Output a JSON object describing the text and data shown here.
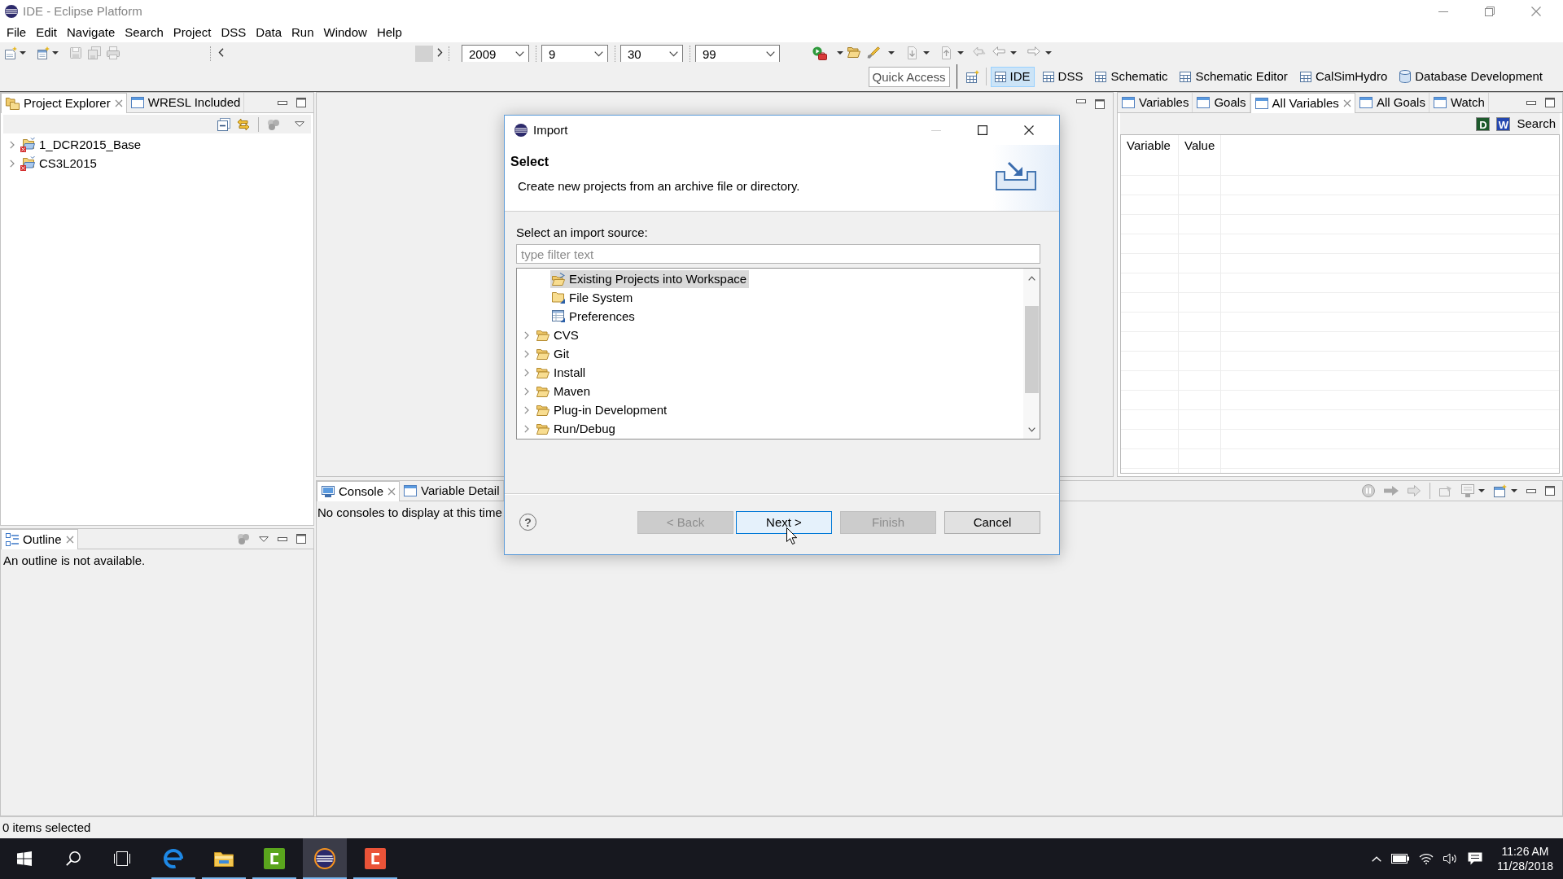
{
  "window": {
    "title": "IDE - Eclipse Platform"
  },
  "menu_bar": [
    "File",
    "Edit",
    "Navigate",
    "Search",
    "Project",
    "DSS",
    "Data",
    "Run",
    "Window",
    "Help"
  ],
  "toolbar": {
    "combos": [
      {
        "value": "2009"
      },
      {
        "value": "9"
      },
      {
        "value": "30"
      },
      {
        "value": "99"
      }
    ],
    "quick_access": {
      "placeholder": "Quick Access"
    },
    "perspectives": [
      {
        "label": "IDE",
        "selected": true
      },
      {
        "label": "DSS",
        "selected": false
      },
      {
        "label": "Schematic",
        "selected": false
      },
      {
        "label": "Schematic Editor",
        "selected": false
      },
      {
        "label": "CalSimHydro",
        "selected": false
      },
      {
        "label": "Database Development",
        "selected": false
      }
    ]
  },
  "project_explorer": {
    "tabs": [
      {
        "label": "Project Explorer",
        "selected": true
      },
      {
        "label": "WRESL Included",
        "selected": false
      }
    ],
    "tree": [
      {
        "label": "1_DCR2015_Base",
        "expanded": false,
        "selected": false
      },
      {
        "label": "CS3L2015",
        "expanded": false,
        "selected": false
      }
    ]
  },
  "outline": {
    "tabs": [
      {
        "label": "Outline",
        "selected": true
      }
    ],
    "message": "An outline is not available."
  },
  "variables_panel": {
    "tabs": [
      {
        "label": "Variables",
        "selected": false
      },
      {
        "label": "Goals",
        "selected": false
      },
      {
        "label": "All Variables",
        "selected": true
      },
      {
        "label": "All Goals",
        "selected": false
      },
      {
        "label": "Watch",
        "selected": false
      }
    ],
    "toolbar": [
      {
        "kind": "badge",
        "label": "D",
        "color": "#1d5a2c"
      },
      {
        "kind": "badge",
        "label": "W",
        "color": "#2447b0"
      },
      {
        "kind": "text",
        "label": "Search"
      }
    ],
    "table": {
      "columns": [
        "Variable",
        "Value"
      ]
    }
  },
  "console_panel": {
    "tabs": [
      {
        "label": "Console",
        "selected": true
      },
      {
        "label": "Variable Detail",
        "selected": false
      }
    ],
    "message": "No consoles to display at this time"
  },
  "status_bar": "0 items selected",
  "dialog": {
    "title": "Import",
    "heading": "Select",
    "description": "Create new projects from an archive file or directory.",
    "source_label": "Select an import source:",
    "filter": {
      "placeholder": "type filter text"
    },
    "tree": [
      {
        "children": [
          {
            "label": "Existing Projects into Workspace",
            "selected": true
          },
          {
            "label": "File System",
            "selected": false
          },
          {
            "label": "Preferences",
            "selected": false
          }
        ]
      },
      {
        "label": "CVS",
        "expanded": false,
        "selected": false
      },
      {
        "label": "Git",
        "expanded": false,
        "selected": false
      },
      {
        "label": "Install",
        "expanded": false,
        "selected": false
      },
      {
        "label": "Maven",
        "expanded": false,
        "selected": false
      },
      {
        "label": "Plug-in Development",
        "expanded": false,
        "selected": false
      },
      {
        "label": "Run/Debug",
        "expanded": false,
        "selected": false
      }
    ],
    "help": "?",
    "buttons": [
      {
        "label": "< Back",
        "disabled": true,
        "focused": false
      },
      {
        "label": "Next >",
        "disabled": false,
        "focused": true
      },
      {
        "label": "Finish",
        "disabled": true,
        "focused": false
      },
      {
        "label": "Cancel",
        "disabled": false,
        "focused": false
      }
    ]
  },
  "taskbar": {
    "apps": [
      {
        "running": true,
        "active": false
      },
      {
        "running": true,
        "active": false
      },
      {
        "running": true,
        "active": false
      },
      {
        "running": true,
        "active": true
      },
      {
        "running": true,
        "active": false
      }
    ],
    "clock": {
      "time": "11:26 AM",
      "date": "11/28/2018"
    }
  }
}
